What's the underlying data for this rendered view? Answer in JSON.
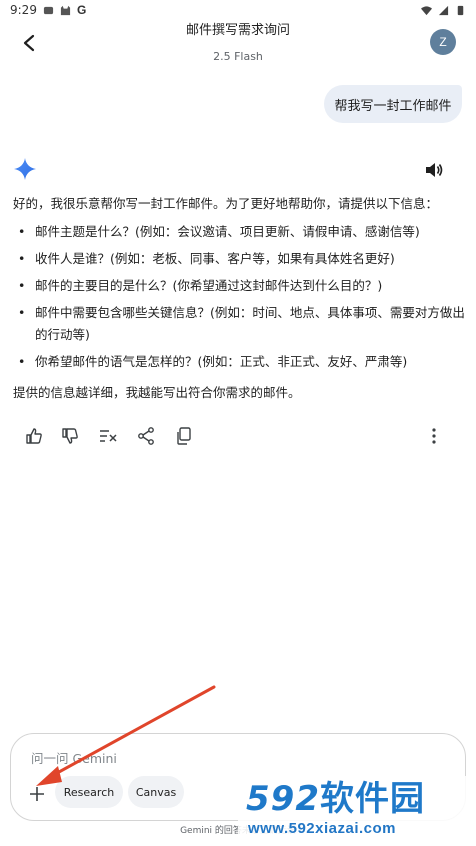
{
  "status_bar": {
    "time": "9:29",
    "g_label": "G"
  },
  "header": {
    "title": "邮件撰写需求询问",
    "model": "2.5 Flash",
    "avatar_letter": "Z"
  },
  "user_message": "帮我写一封工作邮件",
  "response": {
    "intro": "好的，我很乐意帮你写一封工作邮件。为了更好地帮助你，请提供以下信息：",
    "items": [
      "邮件主题是什么？(例如：会议邀请、项目更新、请假申请、感谢信等)",
      "收件人是谁？(例如：老板、同事、客户等，如果有具体姓名更好)",
      "邮件的主要目的是什么？(你希望通过这封邮件达到什么目的？)",
      "邮件中需要包含哪些关键信息？(例如：时间、地点、具体事项、需要对方做出的行动等)",
      "你希望邮件的语气是怎样的？(例如：正式、非正式、友好、严肃等)"
    ],
    "closing": "提供的信息越详细，我越能写出符合你需求的邮件。"
  },
  "icons": [
    "back-icon",
    "gemini-sparkle-icon",
    "speaker-icon",
    "thumbs-up-icon",
    "thumbs-down-icon",
    "modify-response-icon",
    "share-icon",
    "copy-icon",
    "more-vert-icon",
    "plus-icon"
  ],
  "input": {
    "placeholder": "问一问 Gemini",
    "chips": [
      "Research",
      "Canvas"
    ]
  },
  "disclaimer": "Gemini 的回答未必正确无误",
  "watermark": {
    "brand_digits": "592",
    "brand_text": "软件园",
    "url": "www.592xiazai.com"
  },
  "colors": {
    "accent": "#4285f4",
    "bubble": "#e9eef6",
    "annotation_arrow": "#e0452b",
    "watermark": "#1f79c9"
  }
}
